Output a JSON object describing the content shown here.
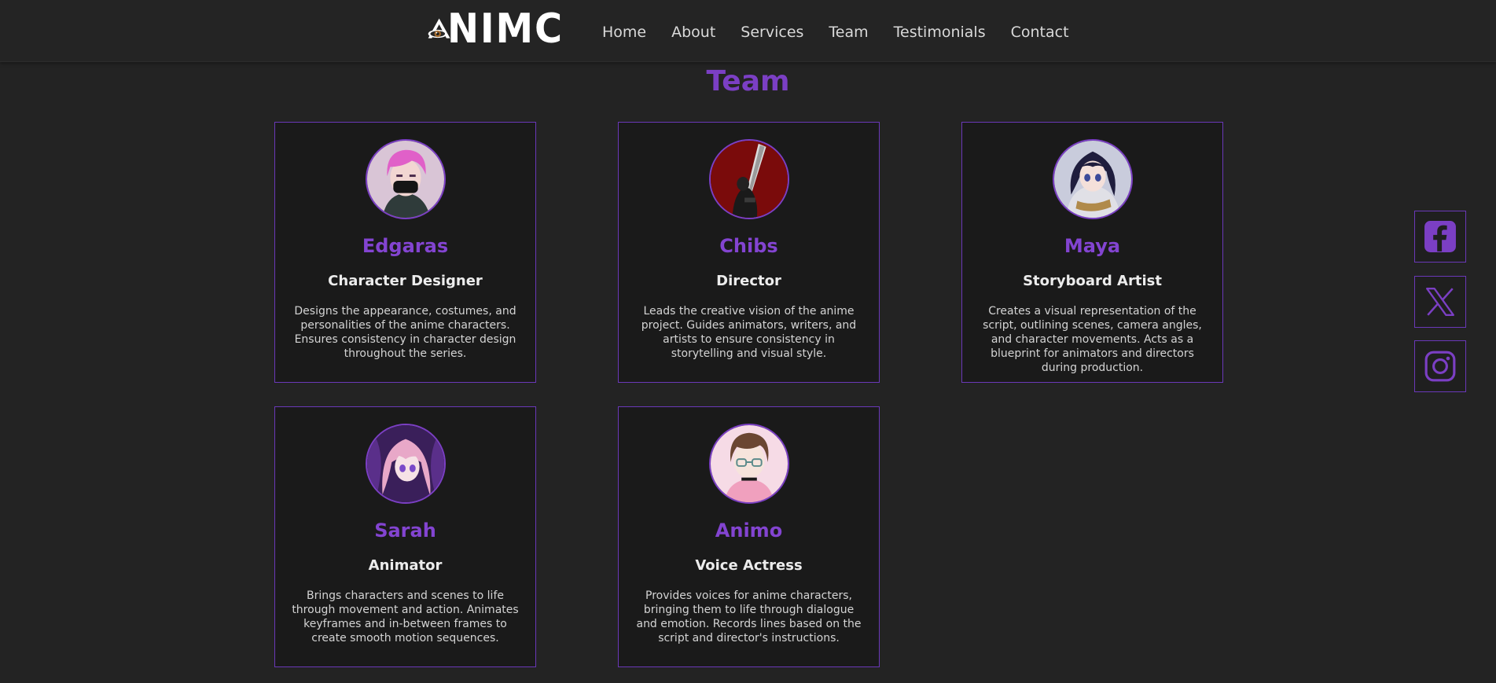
{
  "brand": {
    "logo_text": "NIMC",
    "accent_color": "#7b3fc4"
  },
  "nav": {
    "items": [
      {
        "label": "Home"
      },
      {
        "label": "About"
      },
      {
        "label": "Services"
      },
      {
        "label": "Team"
      },
      {
        "label": "Testimonials"
      },
      {
        "label": "Contact"
      }
    ]
  },
  "team": {
    "title": "Team",
    "members": [
      {
        "name": "Edgaras",
        "role": "Character Designer",
        "description": "Designs the appearance, costumes, and personalities of the anime characters. Ensures consistency in character design throughout the series.",
        "avatar_icon": "pink-hair-masked-avatar"
      },
      {
        "name": "Chibs",
        "role": "Director",
        "description": "Leads the creative vision of the anime project. Guides animators, writers, and artists to ensure consistency in storytelling and visual style.",
        "avatar_icon": "sword-red-background-avatar"
      },
      {
        "name": "Maya",
        "role": "Storyboard Artist",
        "description": "Creates a visual representation of the script, outlining scenes, camera angles, and character movements. Acts as a blueprint for animators and directors during production.",
        "avatar_icon": "dark-hair-girl-avatar"
      },
      {
        "name": "Sarah",
        "role": "Animator",
        "description": "Brings characters and scenes to life through movement and action. Animates keyframes and in-between frames to create smooth motion sequences.",
        "avatar_icon": "pink-hair-girl-avatar"
      },
      {
        "name": "Animo",
        "role": "Voice Actress",
        "description": "Provides voices for anime characters, bringing them to life through dialogue and emotion. Records lines based on the script and director's instructions.",
        "avatar_icon": "brown-hair-glasses-avatar"
      }
    ]
  },
  "social": [
    {
      "icon": "facebook-icon"
    },
    {
      "icon": "x-icon"
    },
    {
      "icon": "instagram-icon"
    }
  ]
}
